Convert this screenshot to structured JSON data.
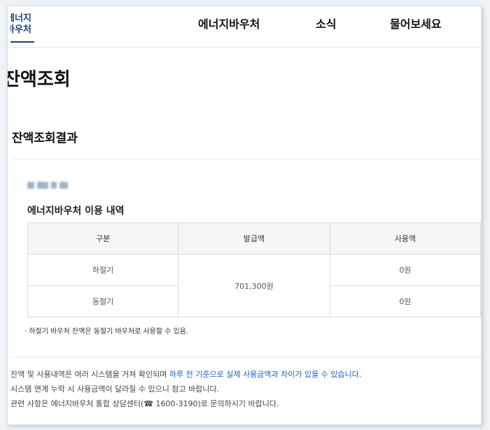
{
  "logo": {
    "line1": "에너지",
    "line2": "바우처"
  },
  "nav": {
    "items": [
      "에너지바우처",
      "소식",
      "물어보세요"
    ]
  },
  "page": {
    "title": "잔액조회"
  },
  "section": {
    "title": "잔액조회결과"
  },
  "usage": {
    "title": "에너지바우처 이용 내역",
    "columns": [
      "구분",
      "발급액",
      "사용액"
    ],
    "rows": [
      {
        "category": "하절기",
        "used": "0원"
      },
      {
        "category": "동절기",
        "used": "0원"
      }
    ],
    "issued": "701,300원",
    "note": "· 하절기 바우처 잔액은 동절기 바우처로 사용할 수 있음."
  },
  "notices": {
    "line1_prefix": "잔액 및 사용내역은 여러 시스템을 거쳐 확인되며 ",
    "line1_highlight": "하루 전 기준으로 실제 사용금액과 차이가 있을 수 있습니다.",
    "line2": "시스템 연계 누락 시 사용금액이 달라질 수 있으니 참고 바랍니다.",
    "line3": "관련 사항은 에너지바우처 통합 상담센터(☎ 1600-3190)로 문의하시기 바랍니다."
  },
  "colors": {
    "brand": "#1d3f72",
    "highlight": "#1d5fb5"
  }
}
